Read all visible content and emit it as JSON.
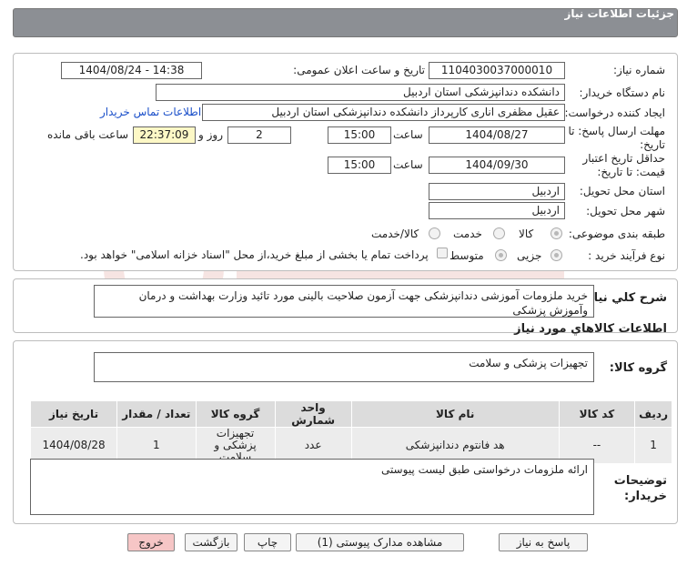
{
  "header": {
    "title": "جزئیات اطلاعات نیاز"
  },
  "form": {
    "need_number": {
      "label": "شماره نیاز:",
      "value": "1104030037000010"
    },
    "announce_datetime": {
      "label": "تاریخ و ساعت اعلان عمومی:",
      "value": "1404/08/24 - 14:38"
    },
    "buyer_org": {
      "label": "نام دستگاه خریدار:",
      "value": "دانشکده دندانپزشکی استان اردبیل"
    },
    "requester": {
      "label": "ایجاد کننده درخواست:",
      "value": "عقیل مظفری اناری کارپرداز دانشکده دندانپزشکی استان اردبیل",
      "contact_link": "اطلاعات تماس خریدار"
    },
    "reply_deadline": {
      "label": "مهلت ارسال پاسخ: تا تاریخ:",
      "date": "1404/08/27",
      "time_label": "ساعت",
      "time": "15:00",
      "days": "2",
      "days_label": "روز و",
      "remaining": "22:37:09",
      "remaining_label": "ساعت باقی مانده"
    },
    "price_validity": {
      "label": "حداقل تاریخ اعتبار قیمت: تا تاریخ:",
      "date": "1404/09/30",
      "time_label": "ساعت",
      "time": "15:00"
    },
    "delivery_province": {
      "label": "استان محل تحویل:",
      "value": "اردبیل"
    },
    "delivery_city": {
      "label": "شهر محل تحویل:",
      "value": "اردبیل"
    },
    "category": {
      "label": "طبقه بندی موضوعی:",
      "options": [
        "کالا",
        "خدمت",
        "کالا/خدمت"
      ],
      "selected": "کالا"
    },
    "purchase_process": {
      "label": "نوع فرآیند خرید :",
      "options": [
        "جزیی",
        "متوسط"
      ],
      "selected": "جزیی",
      "payment_note": "پرداخت تمام یا بخشی از مبلغ خرید،از محل \"اسناد خزانه اسلامی\" خواهد بود."
    }
  },
  "summary": {
    "label": "شرح کلي نياز:",
    "value": "خرید ملزومات آموزشی دندانپزشکی جهت آزمون صلاحیت بالینی مورد تائید وزارت بهداشت و درمان وآموزش پزشکی"
  },
  "goods": {
    "section_title": "اطلاعات کالاهاي مورد نياز",
    "group_label": "گروه کالا:",
    "group_value": "تجهیزات پزشکی و سلامت",
    "table": {
      "headers": [
        "ردیف",
        "کد کالا",
        "نام کالا",
        "واحد شمارش",
        "گروه کالا",
        "تعداد / مقدار",
        "تاریخ نیاز"
      ],
      "rows": [
        [
          "1",
          "--",
          "هد فانتوم دندانپزشکی",
          "عدد",
          "تجهیزات پزشکی و سلامت",
          "1",
          "1404/08/28"
        ]
      ]
    }
  },
  "buyer_notes": {
    "label": "توضیحات خریدار:",
    "value": "ارائه ملزومات درخواستی طبق لیست پیوستی"
  },
  "buttons": {
    "reply": "پاسخ به نیاز",
    "attachments": "مشاهده مدارک پیوستی (1)",
    "print": "چاپ",
    "back": "بازگشت",
    "exit": "خروج"
  },
  "colors": {
    "header_bg": "#8c8f94",
    "remaining_bg": "#fdf8c6",
    "link": "#1a4fc9",
    "exit_bg": "#f6c6c6"
  }
}
